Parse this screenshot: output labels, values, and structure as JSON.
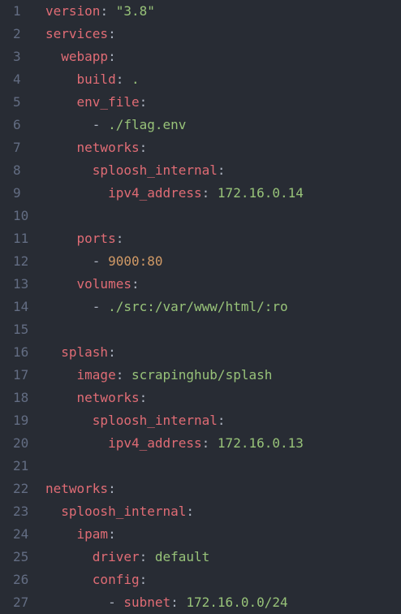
{
  "editor": {
    "lines": [
      {
        "n": "1",
        "indent": "",
        "tokens": [
          {
            "t": "version",
            "c": "key"
          },
          {
            "t": ": ",
            "c": "punc"
          },
          {
            "t": "\"3.8\"",
            "c": "str"
          }
        ]
      },
      {
        "n": "2",
        "indent": "",
        "tokens": [
          {
            "t": "services",
            "c": "key"
          },
          {
            "t": ":",
            "c": "punc"
          }
        ]
      },
      {
        "n": "3",
        "indent": "  ",
        "tokens": [
          {
            "t": "webapp",
            "c": "key"
          },
          {
            "t": ":",
            "c": "punc"
          }
        ]
      },
      {
        "n": "4",
        "indent": "    ",
        "tokens": [
          {
            "t": "build",
            "c": "key"
          },
          {
            "t": ": ",
            "c": "punc"
          },
          {
            "t": ".",
            "c": "plain"
          }
        ]
      },
      {
        "n": "5",
        "indent": "    ",
        "tokens": [
          {
            "t": "env_file",
            "c": "key"
          },
          {
            "t": ":",
            "c": "punc"
          }
        ]
      },
      {
        "n": "6",
        "indent": "      ",
        "tokens": [
          {
            "t": "- ",
            "c": "dash"
          },
          {
            "t": "./flag.env",
            "c": "plain"
          }
        ]
      },
      {
        "n": "7",
        "indent": "    ",
        "tokens": [
          {
            "t": "networks",
            "c": "key"
          },
          {
            "t": ":",
            "c": "punc"
          }
        ]
      },
      {
        "n": "8",
        "indent": "      ",
        "tokens": [
          {
            "t": "sploosh_internal",
            "c": "key"
          },
          {
            "t": ":",
            "c": "punc"
          }
        ]
      },
      {
        "n": "9",
        "indent": "        ",
        "tokens": [
          {
            "t": "ipv4_address",
            "c": "key"
          },
          {
            "t": ": ",
            "c": "punc"
          },
          {
            "t": "172.16.0.14",
            "c": "plain"
          }
        ]
      },
      {
        "n": "10",
        "indent": "",
        "tokens": []
      },
      {
        "n": "11",
        "indent": "    ",
        "tokens": [
          {
            "t": "ports",
            "c": "key"
          },
          {
            "t": ":",
            "c": "punc"
          }
        ]
      },
      {
        "n": "12",
        "indent": "      ",
        "tokens": [
          {
            "t": "- ",
            "c": "dash"
          },
          {
            "t": "9000:80",
            "c": "num"
          }
        ]
      },
      {
        "n": "13",
        "indent": "    ",
        "tokens": [
          {
            "t": "volumes",
            "c": "key"
          },
          {
            "t": ":",
            "c": "punc"
          }
        ]
      },
      {
        "n": "14",
        "indent": "      ",
        "tokens": [
          {
            "t": "- ",
            "c": "dash"
          },
          {
            "t": "./src:/var/www/html/:ro",
            "c": "plain"
          }
        ]
      },
      {
        "n": "15",
        "indent": "",
        "tokens": []
      },
      {
        "n": "16",
        "indent": "  ",
        "tokens": [
          {
            "t": "splash",
            "c": "key"
          },
          {
            "t": ":",
            "c": "punc"
          }
        ]
      },
      {
        "n": "17",
        "indent": "    ",
        "tokens": [
          {
            "t": "image",
            "c": "key"
          },
          {
            "t": ": ",
            "c": "punc"
          },
          {
            "t": "scrapinghub/splash",
            "c": "plain"
          }
        ]
      },
      {
        "n": "18",
        "indent": "    ",
        "tokens": [
          {
            "t": "networks",
            "c": "key"
          },
          {
            "t": ":",
            "c": "punc"
          }
        ]
      },
      {
        "n": "19",
        "indent": "      ",
        "tokens": [
          {
            "t": "sploosh_internal",
            "c": "key"
          },
          {
            "t": ":",
            "c": "punc"
          }
        ]
      },
      {
        "n": "20",
        "indent": "        ",
        "tokens": [
          {
            "t": "ipv4_address",
            "c": "key"
          },
          {
            "t": ": ",
            "c": "punc"
          },
          {
            "t": "172.16.0.13",
            "c": "plain"
          }
        ]
      },
      {
        "n": "21",
        "indent": "",
        "tokens": []
      },
      {
        "n": "22",
        "indent": "",
        "tokens": [
          {
            "t": "networks",
            "c": "key"
          },
          {
            "t": ":",
            "c": "punc"
          }
        ]
      },
      {
        "n": "23",
        "indent": "  ",
        "tokens": [
          {
            "t": "sploosh_internal",
            "c": "key"
          },
          {
            "t": ":",
            "c": "punc"
          }
        ]
      },
      {
        "n": "24",
        "indent": "    ",
        "tokens": [
          {
            "t": "ipam",
            "c": "key"
          },
          {
            "t": ":",
            "c": "punc"
          }
        ]
      },
      {
        "n": "25",
        "indent": "      ",
        "tokens": [
          {
            "t": "driver",
            "c": "key"
          },
          {
            "t": ": ",
            "c": "punc"
          },
          {
            "t": "default",
            "c": "plain"
          }
        ]
      },
      {
        "n": "26",
        "indent": "      ",
        "tokens": [
          {
            "t": "config",
            "c": "key"
          },
          {
            "t": ":",
            "c": "punc"
          }
        ]
      },
      {
        "n": "27",
        "indent": "        ",
        "tokens": [
          {
            "t": "- ",
            "c": "dash"
          },
          {
            "t": "subnet",
            "c": "key"
          },
          {
            "t": ": ",
            "c": "punc"
          },
          {
            "t": "172.16.0.0/24",
            "c": "plain"
          }
        ]
      }
    ]
  },
  "colors": {
    "background": "#282c34",
    "line_number": "#636d83",
    "key": "#e06c75",
    "string": "#98c379",
    "number": "#d19a66",
    "punctuation": "#abb2bf"
  }
}
